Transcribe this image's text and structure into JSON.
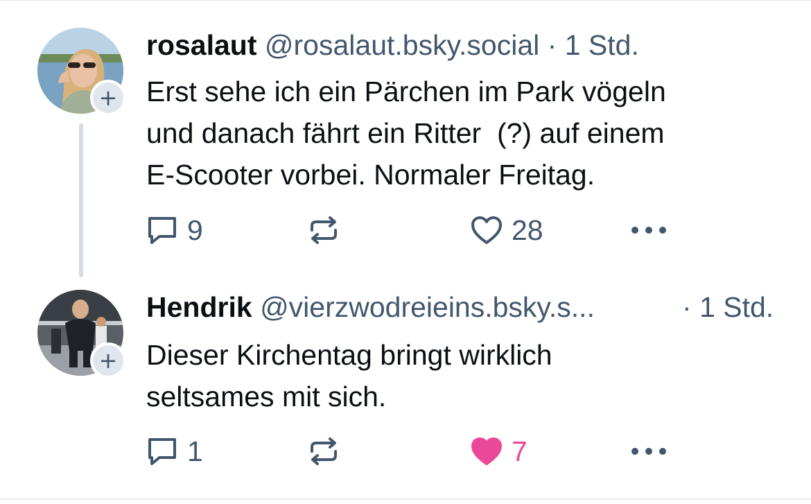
{
  "colors": {
    "text_primary": "#0b0f14",
    "text_secondary": "#42576c",
    "thread_line": "#d4dbe4",
    "follow_bg": "#dfe6ee",
    "like_active": "#ec4899"
  },
  "posts": [
    {
      "author": {
        "display_name": "rosalaut",
        "handle": "@rosalaut.bsky.social",
        "avatar_icon": "avatar-photo"
      },
      "separator": "·",
      "time": "1 Std.",
      "follow_label": "+",
      "text": "Erst sehe ich ein Pärchen im Park vögeln\nund danach fährt ein Ritter  (?) auf einem\nE-Scooter vorbei. Normaler Freitag.",
      "actions": {
        "reply_icon": "comment-icon",
        "reply_count": "9",
        "repost_icon": "repost-icon",
        "repost_count": "",
        "like_icon": "heart-outline-icon",
        "like_count": "28",
        "liked": false,
        "more_icon": "more-dots-icon"
      }
    },
    {
      "author": {
        "display_name": "Hendrik",
        "handle": "@vierzwodreieins.bsky.s...",
        "avatar_icon": "avatar-photo"
      },
      "separator": "·",
      "time": "1 Std.",
      "follow_label": "+",
      "text": "Dieser Kirchentag bringt wirklich\nseltsames mit sich.",
      "actions": {
        "reply_icon": "comment-icon",
        "reply_count": "1",
        "repost_icon": "repost-icon",
        "repost_count": "",
        "like_icon": "heart-filled-icon",
        "like_count": "7",
        "liked": true,
        "more_icon": "more-dots-icon"
      }
    }
  ]
}
